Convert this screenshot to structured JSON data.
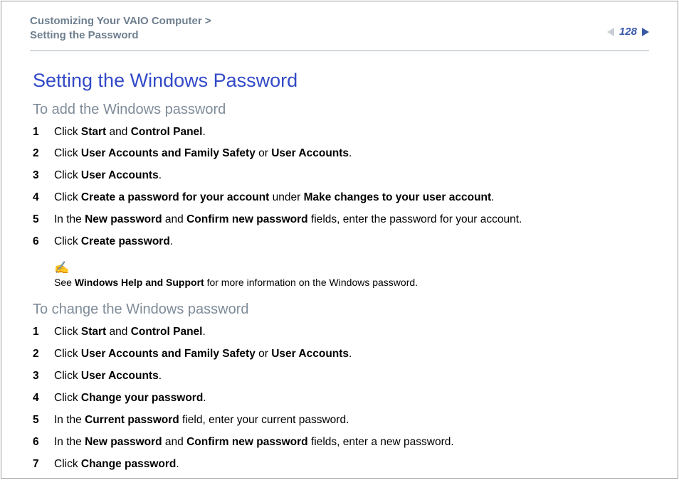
{
  "header": {
    "breadcrumb_line1": "Customizing Your VAIO Computer >",
    "breadcrumb_line2": "Setting the Password",
    "page_number": "128"
  },
  "title": "Setting the Windows Password",
  "section_add": {
    "heading": "To add the Windows password",
    "steps": [
      {
        "pre": "Click ",
        "b1": "Start",
        "mid": " and ",
        "b2": "Control Panel",
        "post": "."
      },
      {
        "pre": "Click ",
        "b1": "User Accounts and Family Safety",
        "mid": " or ",
        "b2": "User Accounts",
        "post": "."
      },
      {
        "pre": "Click ",
        "b1": "User Accounts",
        "mid": "",
        "b2": "",
        "post": "."
      },
      {
        "pre": "Click ",
        "b1": "Create a password for your account",
        "mid": " under ",
        "b2": "Make changes to your user account",
        "post": "."
      },
      {
        "pre": "In the ",
        "b1": "New password",
        "mid": " and ",
        "b2": "Confirm new password",
        "post": " fields, enter the password for your account."
      },
      {
        "pre": "Click ",
        "b1": "Create password",
        "mid": "",
        "b2": "",
        "post": "."
      }
    ]
  },
  "note": {
    "icon": "✍",
    "pre": "See ",
    "bold": "Windows Help and Support",
    "post": " for more information on the Windows password."
  },
  "section_change": {
    "heading": "To change the Windows password",
    "steps": [
      {
        "pre": "Click ",
        "b1": "Start",
        "mid": " and ",
        "b2": "Control Panel",
        "post": "."
      },
      {
        "pre": "Click ",
        "b1": "User Accounts and Family Safety",
        "mid": " or ",
        "b2": "User Accounts",
        "post": "."
      },
      {
        "pre": "Click ",
        "b1": "User Accounts",
        "mid": "",
        "b2": "",
        "post": "."
      },
      {
        "pre": "Click ",
        "b1": "Change your password",
        "mid": "",
        "b2": "",
        "post": "."
      },
      {
        "pre": "In the ",
        "b1": "Current password",
        "mid": "",
        "b2": "",
        "post": " field, enter your current password."
      },
      {
        "pre": "In the ",
        "b1": "New password",
        "mid": " and ",
        "b2": "Confirm new password",
        "post": " fields, enter a new password."
      },
      {
        "pre": "Click ",
        "b1": "Change password",
        "mid": "",
        "b2": "",
        "post": "."
      }
    ]
  }
}
